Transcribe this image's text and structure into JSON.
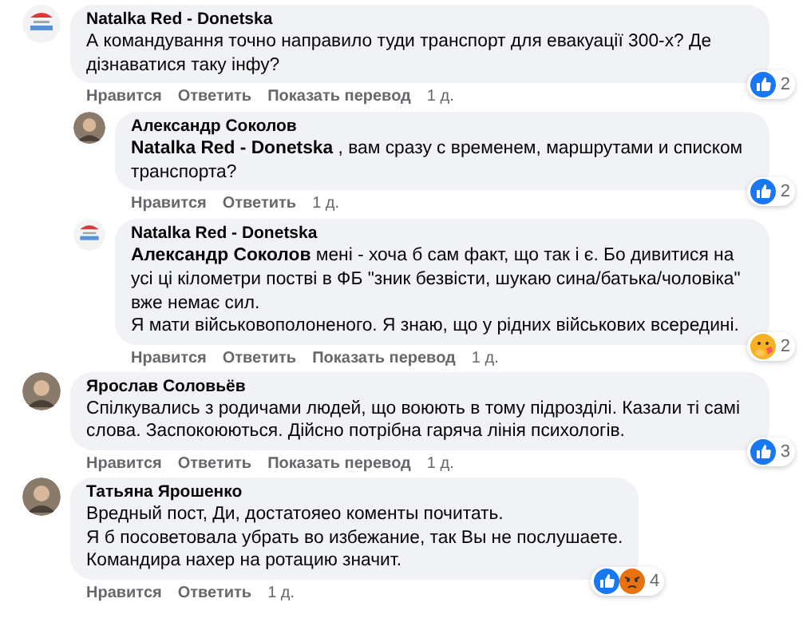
{
  "comments": [
    {
      "author": "Natalka Red - Donetska",
      "avatar": {
        "kind": "logo"
      },
      "text": "А командування точно направило туди транспорт для евакуації 300-х? Де дізнаватися таку інфу?",
      "reactions": [
        {
          "kind": "like"
        }
      ],
      "reaction_count": "2",
      "actions": [
        "Нравится",
        "Ответить",
        "Показать перевод"
      ],
      "time": "1 д.",
      "children": [
        {
          "author": "Александр Соколов",
          "avatar": {
            "kind": "person"
          },
          "text": "**Natalka Red - Donetska** , вам сразу с временем, маршрутами и списком транспорта?",
          "reactions": [
            {
              "kind": "like"
            }
          ],
          "reaction_count": "2",
          "actions": [
            "Нравится",
            "Ответить"
          ],
          "time": "1 д."
        },
        {
          "author": "Natalka Red - Donetska",
          "avatar": {
            "kind": "logo"
          },
          "text": "**Александр Соколов** мені - хоча б сам факт, що так і є. Бо дивитися на усі ці кілометри постві в ФБ \"зник безвісти, шукаю сина/батька/чоловіка\" вже немає сил.\nЯ мати військовополоненого. Я знаю, що у рідних військових всередині.",
          "reactions": [
            {
              "kind": "care"
            }
          ],
          "reaction_count": "2",
          "actions": [
            "Нравится",
            "Ответить",
            "Показать перевод"
          ],
          "time": "1 д."
        }
      ]
    },
    {
      "author": "Ярослав Соловьёв",
      "avatar": {
        "kind": "person"
      },
      "text": "Спілкувались з родичами людей, що воюють в тому підрозділі. Казали ті самі слова. Заспокоюються. Дійсно потрібна гаряча лінія психологів.",
      "reactions": [
        {
          "kind": "like"
        }
      ],
      "reaction_count": "3",
      "actions": [
        "Нравится",
        "Ответить",
        "Показать перевод"
      ],
      "time": "1 д."
    },
    {
      "author": "Татьяна Ярошенко",
      "avatar": {
        "kind": "person"
      },
      "text": "Вредный пост, Ди, достатояео коменты почитать.\nЯ б посоветовала убрать во избежание, так Вы не послушаете.\nКомандира нахер на ротацию значит.",
      "reactions": [
        {
          "kind": "like"
        },
        {
          "kind": "angry"
        }
      ],
      "reaction_count": "4",
      "actions": [
        "Нравится",
        "Ответить"
      ],
      "time": "1 д."
    }
  ]
}
